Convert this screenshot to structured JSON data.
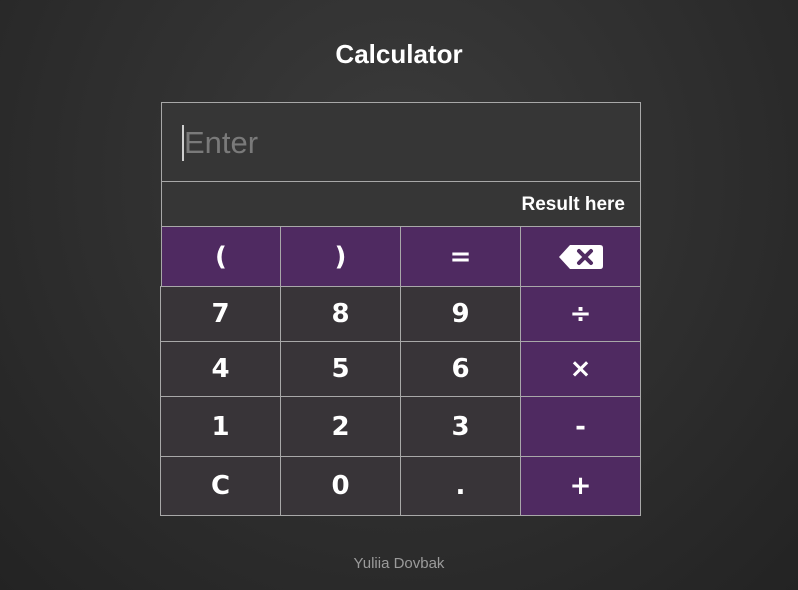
{
  "page": {
    "title": "Calculator",
    "footer": "Yuliia Dovbak"
  },
  "input": {
    "placeholder": "Enter",
    "value": ""
  },
  "result": {
    "text": "Result here"
  },
  "keys": [
    {
      "label": "(",
      "type": "op"
    },
    {
      "label": ")",
      "type": "op"
    },
    {
      "label": "=",
      "type": "op"
    },
    {
      "label": "",
      "type": "op",
      "icon": "backspace-icon"
    },
    {
      "label": "7",
      "type": "num"
    },
    {
      "label": "8",
      "type": "num"
    },
    {
      "label": "9",
      "type": "num"
    },
    {
      "label": "÷",
      "type": "op"
    },
    {
      "label": "4",
      "type": "num"
    },
    {
      "label": "5",
      "type": "num"
    },
    {
      "label": "6",
      "type": "num"
    },
    {
      "label": "×",
      "type": "op"
    },
    {
      "label": "1",
      "type": "num"
    },
    {
      "label": "2",
      "type": "num"
    },
    {
      "label": "3",
      "type": "num"
    },
    {
      "label": "-",
      "type": "op"
    },
    {
      "label": "C",
      "type": "num"
    },
    {
      "label": "0",
      "type": "num"
    },
    {
      "label": ".",
      "type": "num"
    },
    {
      "label": "+",
      "type": "op"
    }
  ],
  "colors": {
    "operator_key": "#4f2a61",
    "number_key": "#383438",
    "border": "#a8a8a8",
    "background": "#2e2e2e"
  }
}
